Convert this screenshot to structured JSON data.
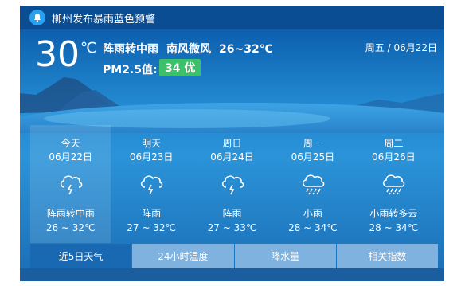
{
  "alert": {
    "icon": "bell-icon",
    "text": "柳州发布暴雨蓝色预警"
  },
  "current": {
    "temperature": "30",
    "unit": "℃",
    "weather": "阵雨转中雨",
    "wind": "南风微风",
    "range": "26~32℃",
    "pm_label": "PM2.5值:",
    "pm_value": "34 优",
    "date": "周五 / 06月22日"
  },
  "forecast": [
    {
      "name": "今天",
      "date": "06月22日",
      "icon": "thunderstorm-cloud-icon",
      "weather": "阵雨转中雨",
      "temp": "26 ~ 32℃"
    },
    {
      "name": "明天",
      "date": "06月23日",
      "icon": "thunderstorm-cloud-icon",
      "weather": "阵雨",
      "temp": "27 ~ 32℃"
    },
    {
      "name": "周日",
      "date": "06月24日",
      "icon": "thunderstorm-cloud-icon",
      "weather": "阵雨",
      "temp": "27 ~ 33℃"
    },
    {
      "name": "周一",
      "date": "06月25日",
      "icon": "rain-cloud-icon",
      "weather": "小雨",
      "temp": "28 ~ 34℃"
    },
    {
      "name": "周二",
      "date": "06月26日",
      "icon": "rain-cloud-icon",
      "weather": "小雨转多云",
      "temp": "28 ~ 34℃"
    }
  ],
  "tabs": [
    {
      "label": "近5日天气",
      "active": true
    },
    {
      "label": "24小时温度",
      "active": false
    },
    {
      "label": "降水量",
      "active": false
    },
    {
      "label": "相关指数",
      "active": false
    }
  ],
  "colors": {
    "alert_bar": "#0a4d93",
    "pm_badge": "#3dc06a",
    "active_tab": "#1968b2",
    "inactive_tab": "#7fb2de"
  }
}
